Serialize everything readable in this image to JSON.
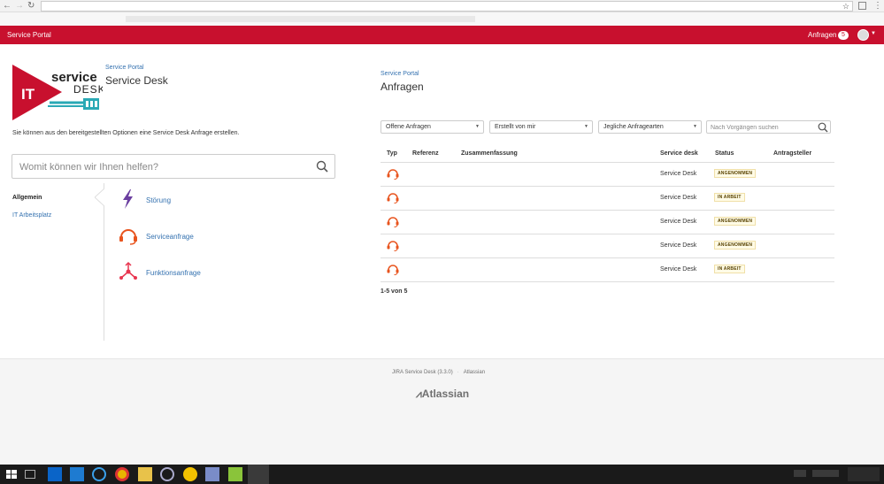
{
  "header": {
    "brand": "Service Portal",
    "requests_label": "Anfragen",
    "requests_count": "5"
  },
  "left": {
    "breadcrumb": "Service Portal",
    "title": "Service Desk",
    "logo": {
      "line1": "service",
      "line2": "DESK",
      "badge": "IT"
    },
    "intro": "Sie können aus den bereitgestellten Optionen eine Service Desk Anfrage erstellen.",
    "search_placeholder": "Womit können wir Ihnen helfen?",
    "categories": [
      {
        "label": "Allgemein",
        "active": true
      },
      {
        "label": "IT Arbeitsplatz",
        "active": false
      }
    ],
    "options": [
      {
        "label": "Störung",
        "icon": "lightning-icon"
      },
      {
        "label": "Serviceanfrage",
        "icon": "headset-icon"
      },
      {
        "label": "Funktionsanfrage",
        "icon": "feature-request-icon"
      }
    ]
  },
  "right": {
    "breadcrumb": "Service Portal",
    "title": "Anfragen",
    "filters": [
      "Offene Anfragen",
      "Erstellt von mir",
      "Jegliche Anfragearten"
    ],
    "search_placeholder": "Nach Vorgängen suchen",
    "columns": [
      "Typ",
      "Referenz",
      "Zusammenfassung",
      "Service desk",
      "Status",
      "Antragsteller"
    ],
    "rows": [
      {
        "service_desk": "Service Desk",
        "status": "ANGENOMMEN"
      },
      {
        "service_desk": "Service Desk",
        "status": "IN ARBEIT"
      },
      {
        "service_desk": "Service Desk",
        "status": "ANGENOMMEN"
      },
      {
        "service_desk": "Service Desk",
        "status": "ANGENOMMEN"
      },
      {
        "service_desk": "Service Desk",
        "status": "IN ARBEIT"
      }
    ],
    "count": "1-5 von 5"
  },
  "footer": {
    "product": "JIRA Service Desk (3.3.0)",
    "vendor": "Atlassian",
    "logo": "Atlassian"
  },
  "colors": {
    "brand_red": "#c8102e",
    "link": "#3572b0",
    "headset": "#e8541e",
    "lightning": "#6b3fa0"
  }
}
